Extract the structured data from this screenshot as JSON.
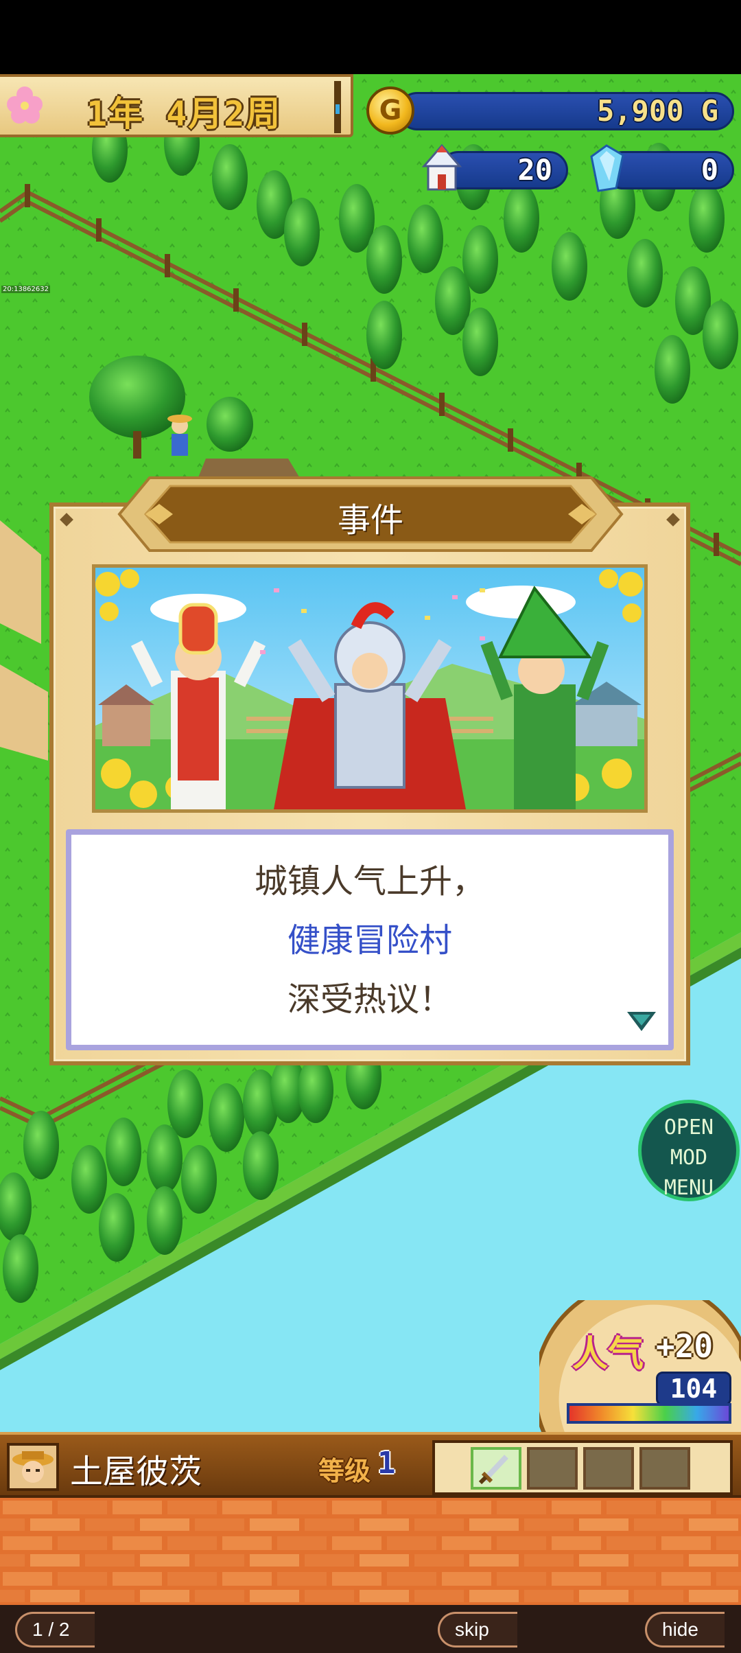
{
  "hud": {
    "date": "1年 4月2周",
    "gold": "5,900 G",
    "coin_letter": "G",
    "houses": "20",
    "crystals": "0",
    "debug_label": "20:13862632"
  },
  "event": {
    "title": "事件",
    "line1": "城镇人气上升，",
    "line2": "健康冒险村",
    "line3": "深受热议！"
  },
  "mod_menu": {
    "line1": "OPEN",
    "line2": "MOD MENU"
  },
  "popularity": {
    "label": "人气",
    "delta": "+20",
    "value": "104",
    "bar_fill_fraction": 1.0
  },
  "character": {
    "name": "土屋彼茨",
    "level_label": "等级",
    "level": "1"
  },
  "bottom_bar": {
    "page": "1 / 2",
    "skip": "skip",
    "hide": "hide"
  },
  "colors": {
    "grass": "#4cc82e",
    "water": "#86e6f4",
    "dialog_highlight": "#3550c8",
    "text_box_border": "#a9a3de"
  }
}
